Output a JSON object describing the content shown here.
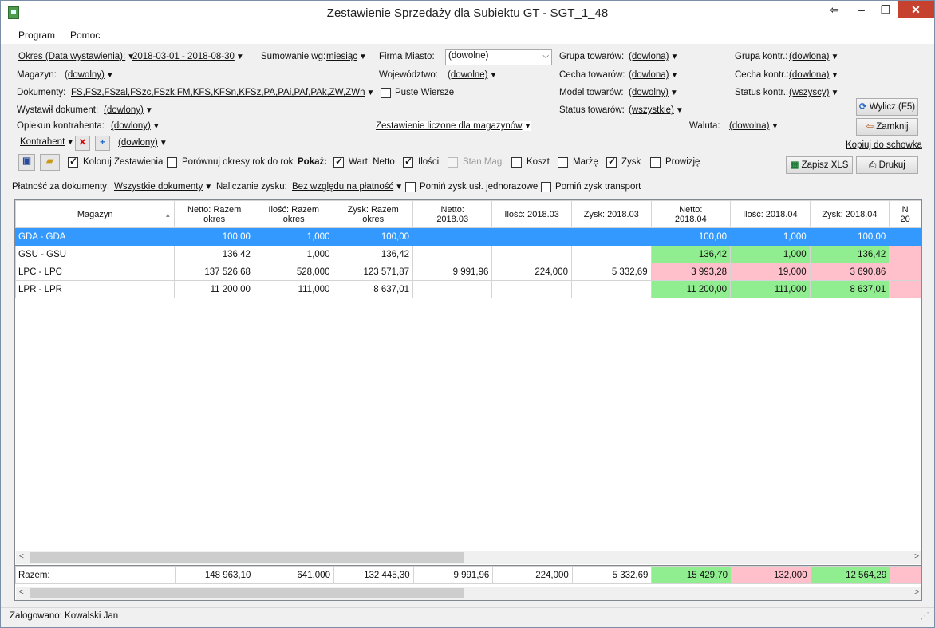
{
  "window": {
    "title": "Zestawienie Sprzedaży dla Subiektu GT - SGT_1_48"
  },
  "menu": {
    "program": "Program",
    "pomoc": "Pomoc"
  },
  "filters": {
    "okres_label": "Okres (Data wystawienia):",
    "okres_value": "2018-03-01 - 2018-08-30",
    "sumowanie_label": "Sumowanie wg:",
    "sumowanie_value": "miesiąc",
    "firma_label": "Firma Miasto:",
    "firma_value": "(dowolne)",
    "grupa_towarow_label": "Grupa towarów:",
    "grupa_towarow_value": "(dowlona)",
    "grupa_kontr_label": "Grupa kontr.:",
    "grupa_kontr_value": "(dowlona)",
    "magazyn_label": "Magazyn:",
    "magazyn_value": "(dowolny)",
    "wojewodztwo_label": "Województwo:",
    "wojewodztwo_value": "(dowolne)",
    "cecha_towarow_label": "Cecha towarów:",
    "cecha_towarow_value": "(dowlona)",
    "cecha_kontr_label": "Cecha kontr.:",
    "cecha_kontr_value": "(dowlona)",
    "dokumenty_label": "Dokumenty:",
    "dokumenty_value": "FS,FSz,FSzal,FSzc,FSzk,FM,KFS,KFSn,KFSz,PA,PAi,PAf,PAk,ZW,ZWn",
    "puste_wiersze": "Puste Wiersze",
    "model_towarow_label": "Model towarów:",
    "model_towarow_value": "(dowolny)",
    "status_kontr_label": "Status kontr.:",
    "status_kontr_value": "(wszyscy)",
    "wystawil_label": "Wystawił dokument:",
    "wystawil_value": "(dowlony)",
    "status_towarow_label": "Status towarów:",
    "status_towarow_value": "(wszystkie)",
    "opiekun_label": "Opiekun kontrahenta:",
    "opiekun_value": "(dowlony)",
    "zestawienie_value": "Zestawienie liczone dla magazynów",
    "waluta_label": "Waluta:",
    "waluta_value": "(dowolna)",
    "kontrahent_label": "Kontrahent",
    "kontrahent_value": "(dowlony)",
    "platnosc_label": "Płatność za dokumenty:",
    "platnosc_value": "Wszystkie dokumenty",
    "naliczanie_label": "Naliczanie zysku:",
    "naliczanie_value": "Bez względu na płatność",
    "pomin_usl": "Pomiń zysk usł. jednorazowe",
    "pomin_transport": "Pomiń zysk transport"
  },
  "options": {
    "koloruj": "Koloruj Zestawienia",
    "porownaj": "Porównuj okresy rok do rok",
    "pokaz": "Pokaż:",
    "netto": "Wart. Netto",
    "ilosci": "Ilości",
    "stan": "Stan Mag.",
    "koszt": "Koszt",
    "marze": "Marżę",
    "zysk": "Zysk",
    "prowizje": "Prowizję"
  },
  "buttons": {
    "wylicz": "Wylicz (F5)",
    "zamknij": "Zamknij",
    "kopiuj": "Kopiuj do schowka",
    "zapisz": "Zapisz XLS",
    "drukuj": "Drukuj"
  },
  "table": {
    "headers": [
      "Magazyn",
      "Netto: Razem\nokres",
      "Ilość: Razem\nokres",
      "Zysk: Razem\nokres",
      "Netto:\n2018.03",
      "Ilość: 2018.03",
      "Zysk: 2018.03",
      "Netto:\n2018.04",
      "Ilość: 2018.04",
      "Zysk: 2018.04",
      "N\n20"
    ],
    "rows": [
      [
        "GDA - GDA",
        "100,00",
        "1,000",
        "100,00",
        "",
        "",
        "",
        "100,00",
        "1,000",
        "100,00",
        ""
      ],
      [
        "GSU - GSU",
        "136,42",
        "1,000",
        "136,42",
        "",
        "",
        "",
        "136,42",
        "1,000",
        "136,42",
        ""
      ],
      [
        "LPC - LPC",
        "137 526,68",
        "528,000",
        "123 571,87",
        "9 991,96",
        "224,000",
        "5 332,69",
        "3 993,28",
        "19,000",
        "3 690,86",
        ""
      ],
      [
        "LPR - LPR",
        "11 200,00",
        "111,000",
        "8 637,01",
        "",
        "",
        "",
        "11 200,00",
        "111,000",
        "8 637,01",
        ""
      ]
    ],
    "totals": [
      "Razem:",
      "148 963,10",
      "641,000",
      "132 445,30",
      "9 991,96",
      "224,000",
      "5 332,69",
      "15 429,70",
      "132,000",
      "12 564,29",
      ""
    ]
  },
  "status": {
    "user": "Zalogowano: Kowalski Jan"
  },
  "colors": {
    "selected": "#3399ff",
    "green": "#90ee90",
    "pink": "#ffc0cb"
  }
}
